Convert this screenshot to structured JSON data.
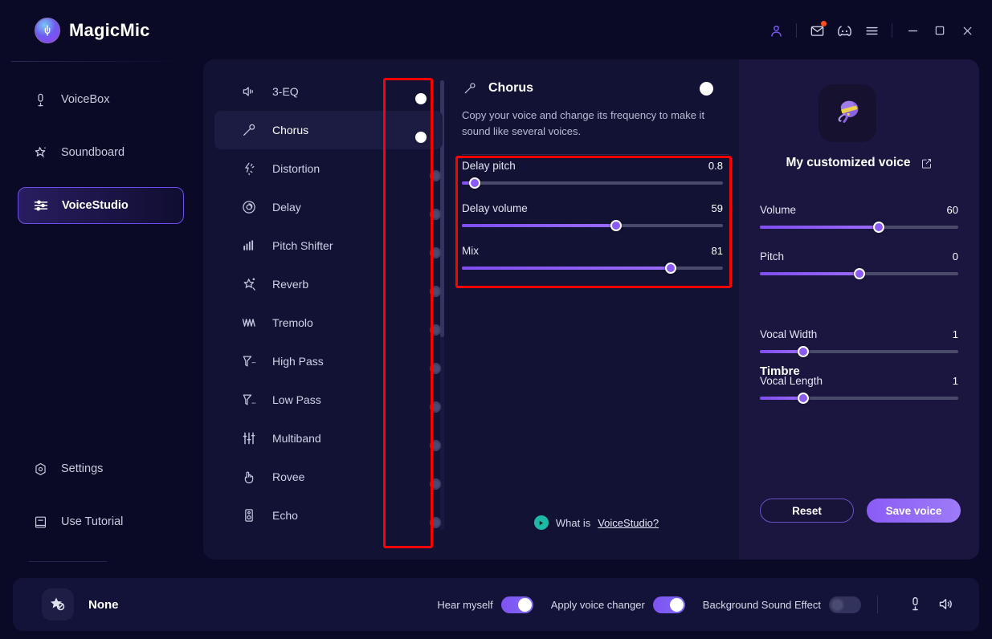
{
  "app": {
    "title": "MagicMic",
    "logo_icon": "microphone-globe-logo"
  },
  "titlebar": {
    "buttons": [
      {
        "name": "account-icon",
        "label": "Account"
      },
      {
        "name": "mail-icon",
        "label": "Messages",
        "badge": true
      },
      {
        "name": "discord-icon",
        "label": "Discord"
      },
      {
        "name": "menu-icon",
        "label": "Menu"
      },
      {
        "name": "minimize-icon",
        "label": "Minimize"
      },
      {
        "name": "maximize-icon",
        "label": "Maximize"
      },
      {
        "name": "close-icon",
        "label": "Close"
      }
    ]
  },
  "sidebar": {
    "items": [
      {
        "label": "VoiceBox",
        "icon": "microphone-icon",
        "active": false
      },
      {
        "label": "Soundboard",
        "icon": "magic-star-icon",
        "active": false
      },
      {
        "label": "VoiceStudio",
        "icon": "sliders-icon",
        "active": true
      }
    ],
    "bottom_items": [
      {
        "label": "Settings",
        "icon": "gear-hex-icon"
      },
      {
        "label": "Use Tutorial",
        "icon": "book-icon"
      }
    ],
    "tray_icons": [
      {
        "name": "toolbox-icon",
        "badge": true
      },
      {
        "name": "mobile-icon",
        "badge": false
      },
      {
        "name": "chat-icon",
        "badge": false
      },
      {
        "name": "feedback-icon",
        "badge": false
      }
    ]
  },
  "effects": {
    "items": [
      {
        "label": "3-EQ",
        "icon": "speaker-icon",
        "enabled": true,
        "selected": false
      },
      {
        "label": "Chorus",
        "icon": "microphone2-icon",
        "enabled": true,
        "selected": true
      },
      {
        "label": "Distortion",
        "icon": "distortion-icon",
        "enabled": false,
        "selected": false
      },
      {
        "label": "Delay",
        "icon": "spiral-icon",
        "enabled": false,
        "selected": false
      },
      {
        "label": "Pitch Shifter",
        "icon": "bars-icon",
        "enabled": false,
        "selected": false
      },
      {
        "label": "Reverb",
        "icon": "sparkle-star-icon",
        "enabled": false,
        "selected": false
      },
      {
        "label": "Tremolo",
        "icon": "wave-icon",
        "enabled": false,
        "selected": false
      },
      {
        "label": "High Pass",
        "icon": "highpass-icon",
        "enabled": false,
        "selected": false
      },
      {
        "label": "Low Pass",
        "icon": "lowpass-icon",
        "enabled": false,
        "selected": false
      },
      {
        "label": "Multiband",
        "icon": "multiband-icon",
        "enabled": false,
        "selected": false
      },
      {
        "label": "Rovee",
        "icon": "hand-icon",
        "enabled": false,
        "selected": false
      },
      {
        "label": "Echo",
        "icon": "echo-icon",
        "enabled": false,
        "selected": false
      }
    ]
  },
  "detail": {
    "title": "Chorus",
    "icon": "microphone2-icon",
    "enabled": true,
    "description": "Copy your voice and change its frequency to make it sound like several voices.",
    "sliders": [
      {
        "label": "Delay pitch",
        "value": "0.8",
        "percent": 5
      },
      {
        "label": "Delay volume",
        "value": "59",
        "percent": 59
      },
      {
        "label": "Mix",
        "value": "81",
        "percent": 80
      }
    ],
    "footer": {
      "prefix": "What is ",
      "link": "VoiceStudio?",
      "play_icon": "play-circle-icon"
    }
  },
  "voice_panel": {
    "avatar_icon": "alien-octopus-avatar",
    "name": "My customized voice",
    "edit_icon": "edit-icon",
    "sliders": [
      {
        "label": "Volume",
        "value": "60",
        "percent": 60
      },
      {
        "label": "Pitch",
        "value": "0",
        "percent": 50
      }
    ],
    "timbre_heading": "Timbre",
    "timbre_sliders": [
      {
        "label": "Vocal Width",
        "value": "1",
        "percent": 22
      },
      {
        "label": "Vocal Length",
        "value": "1",
        "percent": 22
      }
    ],
    "reset_label": "Reset",
    "save_label": "Save voice"
  },
  "bottombar": {
    "voice_icon": "star-none-icon",
    "voice_label": "None",
    "toggles": [
      {
        "label": "Hear myself",
        "enabled": true
      },
      {
        "label": "Apply voice changer",
        "enabled": true
      },
      {
        "label": "Background Sound Effect",
        "enabled": false
      }
    ],
    "icons": [
      {
        "name": "microphone-level-icon"
      },
      {
        "name": "speaker-level-icon"
      }
    ]
  },
  "annotations": {
    "accent": "#ff0000",
    "boxes": [
      {
        "name": "effect-toggles-highlight"
      },
      {
        "name": "chorus-sliders-highlight"
      }
    ]
  }
}
